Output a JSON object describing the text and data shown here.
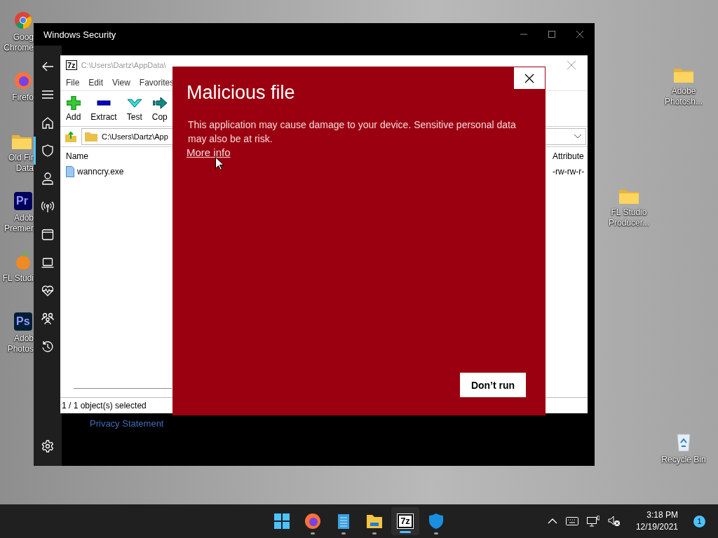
{
  "desktop": {
    "left_icons": [
      {
        "kind": "chrome",
        "label": "Goog\nChrome"
      },
      {
        "kind": "firefox",
        "label": "Firefo"
      },
      {
        "kind": "folder",
        "label": "Old Fir\nData"
      },
      {
        "kind": "tile",
        "logo": "Pr",
        "color": "#00005b",
        "label": "Adob\nPremier"
      },
      {
        "kind": "fruit",
        "label": "FL Studi"
      },
      {
        "kind": "tile",
        "logo": "Ps",
        "color": "#001e36",
        "label": "Adob\nPhotos"
      }
    ],
    "right_icons": [
      {
        "kind": "folder",
        "label": "Adobe\nPhotosh..."
      },
      {
        "kind": "folder",
        "label": "FL Studio\nProducer..."
      },
      {
        "kind": "recycle",
        "label": "Recycle Bin"
      }
    ]
  },
  "security": {
    "title": "Windows Security",
    "nav": [
      {
        "kind": "back",
        "selected": false
      },
      {
        "kind": "menu",
        "selected": false
      },
      {
        "kind": "home",
        "selected": false
      },
      {
        "kind": "shield",
        "selected": true
      },
      {
        "kind": "person",
        "selected": false
      },
      {
        "kind": "antenna",
        "selected": false
      },
      {
        "kind": "window",
        "selected": false
      },
      {
        "kind": "laptop",
        "selected": false
      },
      {
        "kind": "heart",
        "selected": false
      },
      {
        "kind": "family",
        "selected": false
      },
      {
        "kind": "history",
        "selected": false
      }
    ],
    "settings": {
      "selected": false
    },
    "privacy_link": "Privacy Statement"
  },
  "archive": {
    "logo": "7z",
    "title": "C:\\Users\\Dartz\\AppData\\",
    "menu": [
      "File",
      "Edit",
      "View",
      "Favorites"
    ],
    "toolbar": [
      {
        "kind": "add",
        "label": "Add"
      },
      {
        "kind": "extract",
        "label": "Extract"
      },
      {
        "kind": "test",
        "label": "Test"
      },
      {
        "kind": "copy",
        "label": "Cop"
      }
    ],
    "address": "C:\\Users\\Dartz\\App",
    "columns": [
      "Name",
      "Attribute"
    ],
    "rows": [
      {
        "name": "wanncry.exe",
        "attributes": "-rw-rw-r-"
      }
    ],
    "status": "1 / 1 object(s) selected"
  },
  "dialog": {
    "title": "Malicious file",
    "message": "This application may cause damage to your device. Sensitive personal data may also be at risk.",
    "link": "More info",
    "button": "Don’t run"
  },
  "taskbar": {
    "apps": [
      {
        "kind": "start",
        "running": false,
        "selected": false
      },
      {
        "kind": "firefox",
        "running": true,
        "selected": false
      },
      {
        "kind": "notepad",
        "running": true,
        "selected": false
      },
      {
        "kind": "explorer",
        "running": true,
        "selected": false
      },
      {
        "kind": "sevenzip",
        "logo": "7z",
        "running": true,
        "selected": true
      },
      {
        "kind": "defender",
        "running": true,
        "selected": false
      }
    ],
    "tray": {
      "time": "3:18 PM",
      "date": "12/19/2021",
      "notifications": "1"
    }
  }
}
